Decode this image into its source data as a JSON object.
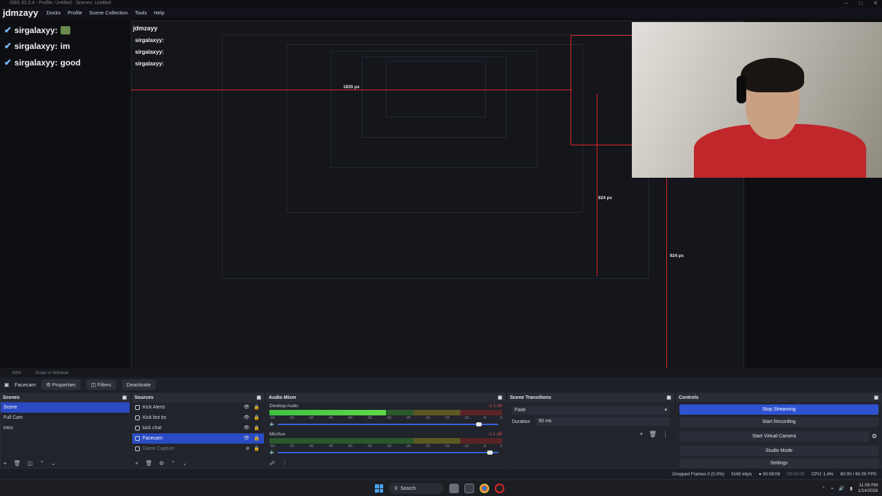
{
  "titlebar": {
    "text": "OBS 32.0.4 - Profile: Untitled - Scenes: Untitled"
  },
  "menubar": {
    "brand": "jdmzayy",
    "items": [
      "Docks",
      "Profile",
      "Scene Collection",
      "Tools",
      "Help"
    ]
  },
  "chat": [
    {
      "user": "sirgalaxyy:",
      "msg": ""
    },
    {
      "user": "sirgalaxyy:",
      "msg": "im"
    },
    {
      "user": "sirgalaxyy:",
      "msg": "good"
    }
  ],
  "measures": {
    "width_label": "1835 px",
    "height_label_a": "924 px",
    "height_label_b": "924 px",
    "small_a": "1835 px",
    "small_b": "924 px"
  },
  "statusstrip": {
    "zoom": "69%",
    "scale": "Scale to Window"
  },
  "srcbar": {
    "source": "Facecam",
    "properties": "Properties",
    "filters": "Filters",
    "deactivate": "Deactivate"
  },
  "scenes": {
    "title": "Scenes",
    "items": [
      "Scene",
      "Full Cam",
      "Intro"
    ],
    "selected": 0
  },
  "sources": {
    "title": "Sources",
    "items": [
      "Kick Alerts",
      "Kick bot tts",
      "kick chat",
      "Facecam",
      "Game Capture"
    ],
    "selected": 3,
    "dim": 4
  },
  "mixer": {
    "title": "Audio Mixer",
    "channels": [
      {
        "name": "Desktop Audio",
        "db": "-3.3 dB",
        "level": 0.5,
        "volume": 0.93
      },
      {
        "name": "Mic/Aux",
        "db": "-0.1 dB",
        "level": 0.0,
        "volume": 0.98
      }
    ],
    "ticks": [
      "-60",
      "-55",
      "-50",
      "-45",
      "-40",
      "-35",
      "-30",
      "-25",
      "-20",
      "-15",
      "-10",
      "-5",
      "0"
    ]
  },
  "transitions": {
    "title": "Scene Transitions",
    "selected": "Fade",
    "duration_label": "Duration",
    "duration": "50 ms"
  },
  "controls": {
    "title": "Controls",
    "buttons": [
      "Stop Streaming",
      "Start Recording",
      "Start Virtual Camera",
      "Studio Mode",
      "Settings"
    ]
  },
  "stats": {
    "dropped": "Dropped Frames 0 (0.0%)",
    "kbps": "5165 kbps",
    "stream_time": "00:08:06",
    "rec_time": "00:00:00",
    "cpu": "CPU: 1.6%",
    "fps": "60.00 / 60.00 FPS"
  },
  "taskbar": {
    "search": "Search",
    "time": "11:58 PM",
    "date": "1/14/2026"
  },
  "colors": {
    "accent": "#2f52d0",
    "selection": "#2a4bc3",
    "measure": "#e0262b",
    "shirt": "#c0272a"
  }
}
